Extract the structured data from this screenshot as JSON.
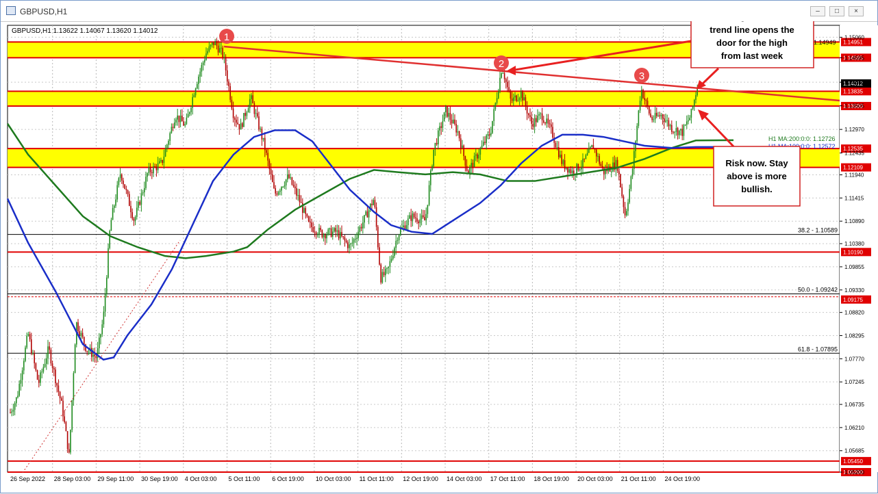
{
  "window": {
    "title": "GBPUSD,H1",
    "buttons": {
      "minimize": "–",
      "maximize": "□",
      "close": "×"
    }
  },
  "chart_data": {
    "type": "candlestick",
    "symbol_header": "GBPUSD,H1  1.13622 1.14067 1.13620 1.14012",
    "ylim": [
      1.052,
      1.1533
    ],
    "current_price": "1.14012",
    "y_ticks": [
      "1.15060",
      "1.14595",
      "1.14040",
      "1.13505",
      "1.12970",
      "1.12435",
      "1.11940",
      "1.11415",
      "1.10890",
      "1.10380",
      "1.09855",
      "1.09330",
      "1.08820",
      "1.08295",
      "1.07770",
      "1.07245",
      "1.06735",
      "1.06210",
      "1.05685",
      "1.05200"
    ],
    "x_ticks": [
      "26 Sep 2022",
      "28 Sep 03:00",
      "29 Sep 11:00",
      "30 Sep 19:00",
      "4 Oct 03:00",
      "5 Oct 11:00",
      "6 Oct 19:00",
      "10 Oct 03:00",
      "11 Oct 11:00",
      "12 Oct 19:00",
      "14 Oct 03:00",
      "17 Oct 11:00",
      "18 Oct 19:00",
      "20 Oct 03:00",
      "21 Oct 11:00",
      "24 Oct 19:00"
    ],
    "zones": [
      {
        "low": 1.14595,
        "high": 1.14951
      },
      {
        "low": 1.135,
        "high": 1.13835
      },
      {
        "low": 1.12109,
        "high": 1.12535
      }
    ],
    "levels": [
      {
        "label": "1.14951",
        "value": 1.14951
      },
      {
        "label": "1.14595",
        "value": 1.14595
      },
      {
        "label": "1.13835",
        "value": 1.13835
      },
      {
        "label": "1.13500",
        "value": 1.135
      },
      {
        "label": "1.12535",
        "value": 1.12535
      },
      {
        "label": "1.12109",
        "value": 1.12109
      },
      {
        "label": "1.10190",
        "value": 1.1019
      },
      {
        "label": "1.05450",
        "value": 1.0545
      },
      {
        "label": "1.05200",
        "value": 1.052
      }
    ],
    "fib_levels": [
      {
        "label": "38.2 - 1.10589",
        "value": 1.10589
      },
      {
        "label": "50.0 - 1.09242",
        "value": 1.09242
      },
      {
        "label": "61.8 - 1.07895",
        "value": 1.07895
      }
    ],
    "fib_level_aux": {
      "label": "1.09175",
      "value": 1.09175
    },
    "top_line_label": "1.14949",
    "ma200": {
      "label": "H1 MA:200:0:0: 1.12726",
      "value": 1.12726
    },
    "ma100": {
      "label": "H1 MA:100:0:0: 1.12572",
      "value": 1.12572
    },
    "trendline": {
      "points": [
        [
          "4 Oct 19:00",
          1.1495
        ],
        [
          "25 Oct",
          1.1373
        ]
      ]
    },
    "markers": [
      "1",
      "2",
      "3"
    ],
    "annotations": [
      "Getting above the trend line opens the door for the high from last week",
      "Risk now. Stay above is more bullish."
    ],
    "colors": {
      "zone": "#ffff00",
      "level": "#e00000",
      "trendline": "#e03030",
      "ma100": "#1a2ec8",
      "ma200": "#1e7a1e",
      "bull_candle": "#1e8a1e",
      "bear_candle": "#b00000",
      "marker": "#e84a4a",
      "fib": "#000000"
    }
  }
}
